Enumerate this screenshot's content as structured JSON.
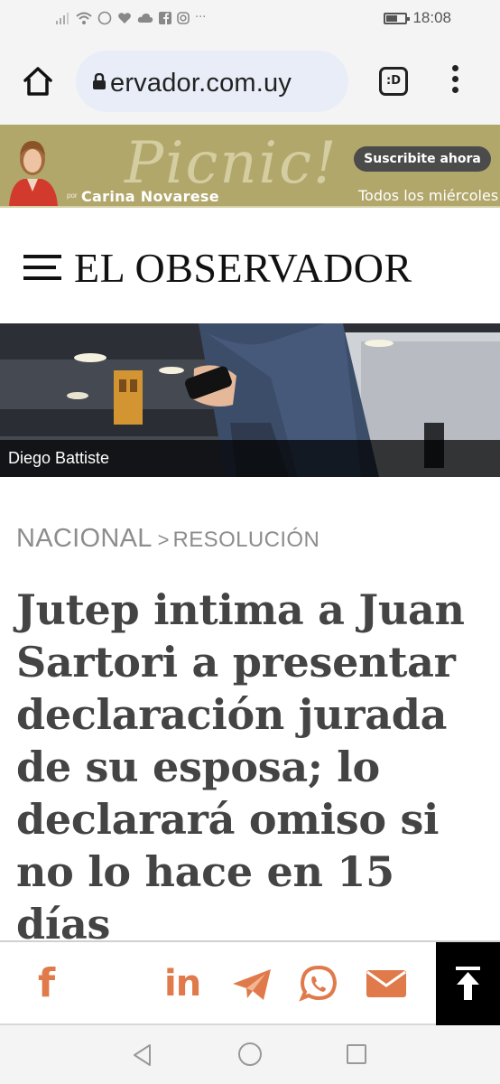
{
  "status_bar": {
    "time": "18:08",
    "more": "···"
  },
  "browser": {
    "url": "elobservador.com.uy",
    "url_visible": "ervador.com.uy",
    "extension_label": ":D",
    "icons": [
      "home-icon",
      "lock-icon",
      "extension-icon",
      "more-vert-icon"
    ]
  },
  "ad": {
    "brand": "Picnic!",
    "byline_prefix": "por",
    "author": "Carina Novarese",
    "cta": "Suscribite ahora",
    "schedule": "Todos los miércoles",
    "background_color": "#b2a76a"
  },
  "site": {
    "logo": "EL OBSERVADOR"
  },
  "hero": {
    "credit": "Diego Battiste"
  },
  "article": {
    "section": "NACIONAL",
    "separator": ">",
    "topic": "RESOLUCIÓN",
    "headline": "Jutep intima a Juan Sartori a presentar declaración jurada de su esposa; lo declarará omiso si no lo hace en 15 días"
  },
  "share": {
    "accent_color": "#e07a4a",
    "facebook": "f",
    "linkedin": "in",
    "icons": [
      "facebook-icon",
      "linkedin-icon",
      "telegram-icon",
      "whatsapp-icon",
      "email-icon",
      "scroll-top-icon"
    ]
  },
  "nav": {
    "icons": [
      "back-icon",
      "home-circle-icon",
      "recent-apps-icon"
    ]
  }
}
